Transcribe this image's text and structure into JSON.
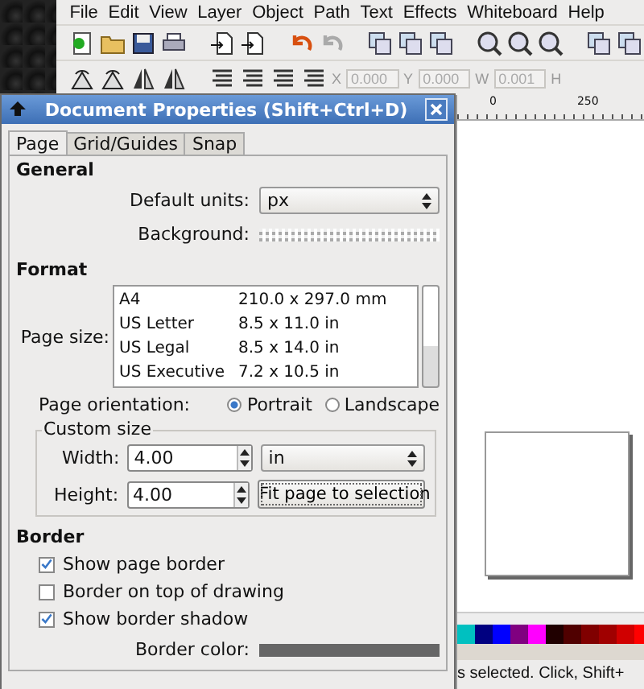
{
  "menu": [
    "File",
    "Edit",
    "View",
    "Layer",
    "Object",
    "Path",
    "Text",
    "Effects",
    "Whiteboard",
    "Help"
  ],
  "toolbar_fields": [
    {
      "label": "X",
      "value": "0.000"
    },
    {
      "label": "Y",
      "value": "0.000"
    },
    {
      "label": "W",
      "value": "0.001"
    },
    {
      "label": "H"
    }
  ],
  "ruler_labels": [
    "0",
    "250"
  ],
  "palette": [
    {
      "color": "#00c0c0"
    },
    {
      "color": "#000080"
    },
    {
      "color": "#0000ff"
    },
    {
      "color": "#800080"
    },
    {
      "color": "#ff00ff"
    },
    {
      "color": "#200000"
    },
    {
      "color": "#500000"
    },
    {
      "color": "#800000"
    },
    {
      "color": "#a00000"
    },
    {
      "color": "#d00000"
    },
    {
      "color": "#ff0000"
    }
  ],
  "status_bar": "s selected. Click, Shift+",
  "dialog": {
    "title": "Document Properties (Shift+Ctrl+D)",
    "tabs": [
      {
        "label": "Page",
        "selected": true
      },
      {
        "label": "Grid/Guides",
        "selected": false
      },
      {
        "label": "Snap",
        "selected": false
      }
    ],
    "general": {
      "heading": "General",
      "units_label": "Default units:",
      "units_value": "px",
      "background_label": "Background:"
    },
    "format": {
      "heading": "Format",
      "page_size_label": "Page size:",
      "sizes": [
        {
          "name": "A4",
          "size": "210.0 x 297.0 mm"
        },
        {
          "name": "US Letter",
          "size": "8.5 x 11.0 in"
        },
        {
          "name": "US Legal",
          "size": "8.5 x 14.0 in"
        },
        {
          "name": "US Executive",
          "size": "7.2 x 10.5 in"
        }
      ],
      "orientation_label": "Page orientation:",
      "orientations": [
        {
          "label": "Portrait",
          "selected": true
        },
        {
          "label": "Landscape",
          "selected": false
        }
      ],
      "custom_legend": "Custom size",
      "width_label": "Width:",
      "width_value": "4.00",
      "unit_value": "in",
      "height_label": "Height:",
      "height_value": "4.00",
      "fit_button": "Fit page to selection"
    },
    "border": {
      "heading": "Border",
      "options": [
        {
          "label": "Show page border",
          "checked": true
        },
        {
          "label": "Border on top of drawing",
          "checked": false
        },
        {
          "label": "Show border shadow",
          "checked": true
        }
      ],
      "color_label": "Border color:"
    }
  }
}
